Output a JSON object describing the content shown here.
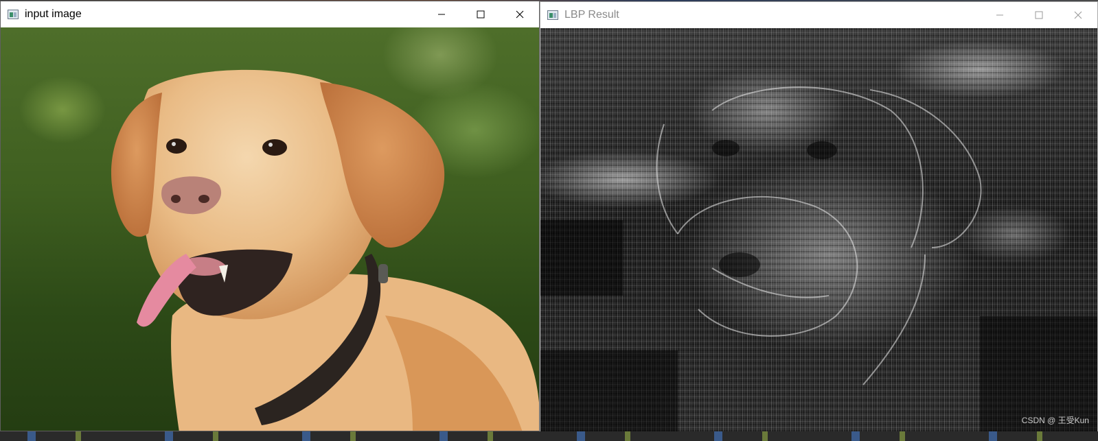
{
  "windows": [
    {
      "title": "input image",
      "image": {
        "name": "labrador-photo",
        "description_icon": "image-canvas"
      }
    },
    {
      "title": "LBP Result",
      "image": {
        "name": "lbp-result-image",
        "description_icon": "image-canvas"
      },
      "watermark": "CSDN @ 王受Kun"
    }
  ],
  "controls": {
    "minimize_icon": "minimize-icon",
    "maximize_icon": "maximize-icon",
    "close_icon": "close-icon"
  },
  "colors": {
    "titlebar_bg": "#ffffff",
    "active_title": "#000000",
    "inactive_title": "#8a8a8a",
    "inactive_controls": "#9a9a9a"
  }
}
